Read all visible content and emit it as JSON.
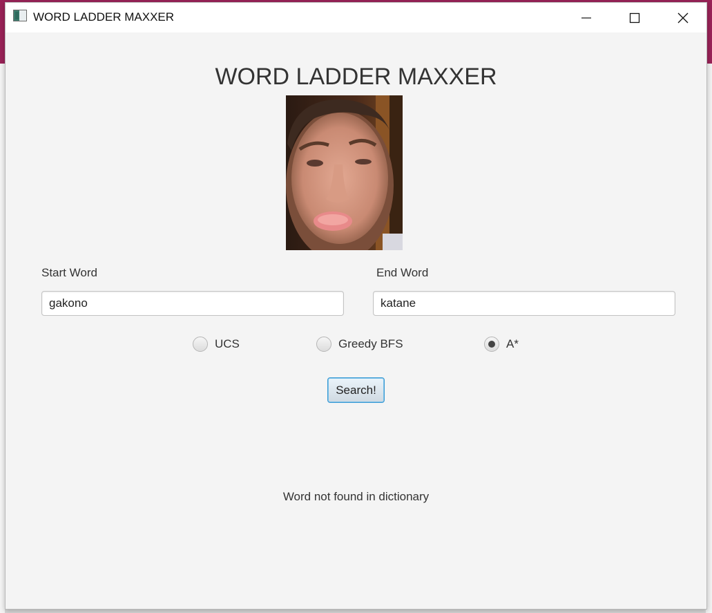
{
  "window": {
    "title": "WORD LADDER MAXXER"
  },
  "app": {
    "heading": "WORD LADDER MAXXER",
    "photo_icon": "portrait-photo"
  },
  "form": {
    "start_label": "Start Word",
    "start_value": "gakono",
    "end_label": "End Word",
    "end_value": "katane"
  },
  "algorithms": [
    {
      "label": "UCS",
      "selected": false
    },
    {
      "label": "Greedy BFS",
      "selected": false
    },
    {
      "label": "A*",
      "selected": true
    }
  ],
  "search_button": "Search!",
  "result_message": "Word not found in dictionary",
  "colors": {
    "window_bg": "#f4f4f4",
    "accent_border": "#3a9bd4"
  }
}
